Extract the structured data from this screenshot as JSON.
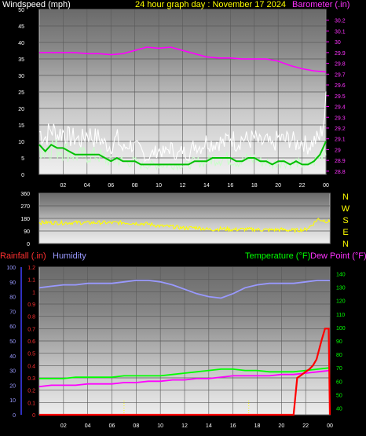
{
  "header": {
    "windspeed_label": "Windspeed (mph)",
    "title": "24 hour graph day : November 17 2024",
    "barometer_label": "Barometer (.in)",
    "rainfall_label": "Rainfall (.in)",
    "humidity_label": "Humidity",
    "temperature_label": "Temperature (°F)",
    "dewpoint_label": "Dew Point (°F)"
  },
  "colors": {
    "wind_gust": "#ffffff",
    "wind_avg_band": "#c8ffc8",
    "wind_avg_line": "#00c000",
    "barometer": "#ff00ff",
    "direction": "#ffff00",
    "rainfall": "#ff0000",
    "humidity": "#9999ff",
    "temperature": "#00ff00",
    "dewpoint": "#ff00ff",
    "title": "#ffff00"
  },
  "chart_data": [
    {
      "type": "line",
      "name": "wind-and-barometer",
      "x_ticks": [
        "02",
        "04",
        "06",
        "08",
        "10",
        "12",
        "14",
        "16",
        "18",
        "20",
        "22",
        "00"
      ],
      "y_left_ticks": [
        "0",
        "5",
        "10",
        "15",
        "20",
        "25",
        "30",
        "35",
        "40",
        "45",
        "50"
      ],
      "y_left_range": [
        0,
        50
      ],
      "y_right_ticks": [
        "28.8",
        "28.9",
        "29",
        "29.1",
        "29.2",
        "29.3",
        "29.4",
        "29.5",
        "29.6",
        "29.7",
        "29.8",
        "29.9",
        "30",
        "30.1",
        "30.2"
      ],
      "y_right_range": [
        28.77,
        30.3
      ],
      "x_range": [
        0,
        24
      ],
      "series": [
        {
          "name": "Windspeed (mph)",
          "axis": "left",
          "kind": "gust",
          "x": [
            0,
            0.5,
            1,
            1.5,
            2,
            2.5,
            3,
            3.5,
            4,
            4.5,
            5,
            5.5,
            6,
            6.5,
            7,
            7.5,
            8,
            8.5,
            9,
            9.5,
            10,
            10.5,
            11,
            11.5,
            12,
            12.5,
            13,
            13.5,
            14,
            14.5,
            15,
            15.5,
            16,
            16.5,
            17,
            17.5,
            18,
            18.5,
            19,
            19.5,
            20,
            20.5,
            21,
            21.5,
            22,
            22.5,
            23,
            23.5,
            24
          ],
          "values": [
            14,
            12,
            15,
            13,
            14,
            12,
            12,
            11,
            14,
            12,
            12,
            10,
            9,
            12,
            8,
            10,
            9,
            8,
            5,
            7,
            8,
            7,
            9,
            6,
            8,
            6,
            10,
            9,
            11,
            10,
            11,
            10,
            13,
            10,
            12,
            11,
            12,
            10,
            11,
            9,
            12,
            11,
            12,
            10,
            11,
            9,
            11,
            12,
            22
          ]
        },
        {
          "name": "Average wind (mph)",
          "axis": "left",
          "kind": "avg",
          "x": [
            0,
            0.5,
            1,
            1.5,
            2,
            2.5,
            3,
            3.5,
            4,
            4.5,
            5,
            5.5,
            6,
            6.5,
            7,
            7.5,
            8,
            8.5,
            9,
            9.5,
            10,
            10.5,
            11,
            11.5,
            12,
            12.5,
            13,
            13.5,
            14,
            14.5,
            15,
            15.5,
            16,
            16.5,
            17,
            17.5,
            18,
            18.5,
            19,
            19.5,
            20,
            20.5,
            21,
            21.5,
            22,
            22.5,
            23,
            23.5,
            24
          ],
          "values": [
            9,
            7,
            9,
            8,
            8,
            7,
            6,
            6,
            6,
            6,
            6,
            5,
            4,
            5,
            4,
            4,
            4,
            3,
            3,
            3,
            3,
            3,
            3,
            3,
            3,
            3,
            4,
            4,
            4,
            5,
            5,
            5,
            5,
            4,
            4,
            5,
            5,
            4,
            4,
            3,
            4,
            4,
            3,
            4,
            3,
            3,
            4,
            6,
            10
          ]
        },
        {
          "name": "Barometer (.in)",
          "axis": "right",
          "kind": "line",
          "x": [
            0,
            1,
            2,
            3,
            4,
            5,
            6,
            7,
            8,
            9,
            10,
            11,
            12,
            13,
            14,
            15,
            16,
            17,
            18,
            19,
            20,
            21,
            22,
            23,
            24
          ],
          "values": [
            29.9,
            29.9,
            29.9,
            29.9,
            29.89,
            29.89,
            29.88,
            29.89,
            29.92,
            29.95,
            29.94,
            29.95,
            29.92,
            29.89,
            29.86,
            29.85,
            29.85,
            29.84,
            29.84,
            29.84,
            29.82,
            29.78,
            29.75,
            29.73,
            29.72
          ]
        }
      ]
    },
    {
      "type": "line",
      "name": "wind-direction",
      "x_range": [
        0,
        24
      ],
      "y_range": [
        0,
        360
      ],
      "y_ticks": [
        "0",
        "90",
        "180",
        "270",
        "360"
      ],
      "compass_labels": [
        "N",
        "W",
        "S",
        "E",
        "N"
      ],
      "series": [
        {
          "name": "Wind direction",
          "kind": "line",
          "x": [
            0,
            1,
            2,
            3,
            4,
            5,
            6,
            7,
            8,
            9,
            10,
            11,
            12,
            13,
            14,
            15,
            16,
            17,
            18,
            19,
            20,
            21,
            22,
            22.5,
            23,
            23.5,
            24
          ],
          "values": [
            150,
            150,
            148,
            150,
            148,
            150,
            148,
            150,
            145,
            140,
            125,
            120,
            110,
            115,
            100,
            105,
            100,
            102,
            100,
            97,
            100,
            94,
            100,
            130,
            175,
            165,
            155
          ]
        }
      ]
    },
    {
      "type": "line",
      "name": "rain-humidity-temperature",
      "x_ticks": [
        "02",
        "04",
        "06",
        "08",
        "10",
        "12",
        "14",
        "16",
        "18",
        "20",
        "22",
        "00"
      ],
      "x_range": [
        0,
        24
      ],
      "y_left_humidity_ticks": [
        "0",
        "10",
        "20",
        "30",
        "40",
        "50",
        "60",
        "70",
        "80",
        "90",
        "100"
      ],
      "y_left_humidity_range": [
        0,
        100
      ],
      "y_left_rain_ticks": [
        "0",
        "0.1",
        "0.2",
        "0.3",
        "0.4",
        "0.5",
        "0.6",
        "0.7",
        "0.8",
        "0.9",
        "1",
        "1.1",
        "1.2"
      ],
      "y_left_rain_range": [
        0,
        1.2
      ],
      "y_right_ticks": [
        "40",
        "50",
        "60",
        "70",
        "80",
        "90",
        "100",
        "110",
        "120",
        "130",
        "140"
      ],
      "y_right_range": [
        35,
        145
      ],
      "series": [
        {
          "name": "Humidity",
          "axis": "humidity",
          "kind": "line",
          "x": [
            0,
            1,
            2,
            3,
            4,
            5,
            6,
            7,
            8,
            9,
            10,
            11,
            12,
            13,
            14,
            15,
            16,
            17,
            18,
            19,
            20,
            21,
            22,
            23,
            24
          ],
          "values": [
            86,
            87,
            88,
            88,
            89,
            89,
            89,
            90,
            91,
            91,
            90,
            88,
            85,
            82,
            80,
            79,
            82,
            86,
            88,
            89,
            89,
            89,
            90,
            91,
            91
          ]
        },
        {
          "name": "Temperature (°F)",
          "axis": "right",
          "kind": "line",
          "x": [
            0,
            1,
            2,
            3,
            4,
            5,
            6,
            7,
            8,
            9,
            10,
            11,
            12,
            13,
            14,
            15,
            16,
            17,
            18,
            19,
            20,
            21,
            22,
            23,
            24
          ],
          "values": [
            62,
            62,
            62,
            63,
            63,
            63,
            63,
            64,
            64,
            64,
            64,
            65,
            66,
            67,
            68,
            69,
            69,
            68,
            68,
            67,
            67,
            67,
            68,
            69,
            70
          ]
        },
        {
          "name": "Dew Point (°F)",
          "axis": "right",
          "kind": "line",
          "x": [
            0,
            1,
            2,
            3,
            4,
            5,
            6,
            7,
            8,
            9,
            10,
            11,
            12,
            13,
            14,
            15,
            16,
            17,
            18,
            19,
            20,
            21,
            22,
            23,
            24
          ],
          "values": [
            56,
            57,
            57,
            57,
            58,
            58,
            58,
            59,
            59,
            60,
            60,
            61,
            61,
            62,
            62,
            63,
            64,
            64,
            64,
            64,
            65,
            65,
            66,
            67,
            68
          ]
        },
        {
          "name": "Rainfall (.in)",
          "axis": "rain",
          "kind": "step",
          "x": [
            0,
            21,
            21.3,
            21.6,
            22,
            22.3,
            22.6,
            22.9,
            23.3,
            23.6,
            23.9,
            24
          ],
          "values": [
            0,
            0,
            0.3,
            0.32,
            0.35,
            0.37,
            0.4,
            0.45,
            0.6,
            0.7,
            0.7,
            0
          ]
        }
      ]
    }
  ]
}
